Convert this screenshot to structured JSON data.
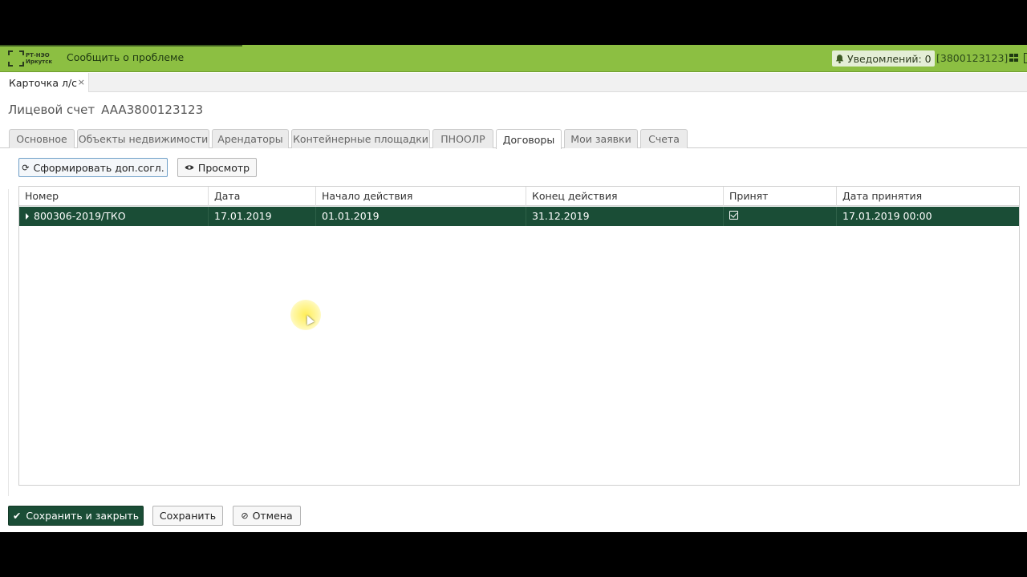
{
  "topbar": {
    "logo_line1": "РТ-НЭО",
    "logo_line2": "Иркутск",
    "report_problem": "Сообщить о проблеме",
    "notifications": "Уведомлений: 0",
    "account_number": "[3800123123]"
  },
  "doc_tab": {
    "label": "Карточка л/с",
    "close": "×"
  },
  "title": {
    "label": "Лицевой счет",
    "account": "AAA3800123123"
  },
  "tabs": [
    {
      "label": "Основное"
    },
    {
      "label": "Объекты недвижимости"
    },
    {
      "label": "Арендаторы"
    },
    {
      "label": "Контейнерные площадки"
    },
    {
      "label": "ПНООЛР"
    },
    {
      "label": "Договоры",
      "active": true
    },
    {
      "label": "Мои заявки"
    },
    {
      "label": "Счета"
    }
  ],
  "toolbar": {
    "generate_label": "Сформировать доп.согл.",
    "view_label": "Просмотр"
  },
  "grid": {
    "columns": [
      "Номер",
      "Дата",
      "Начало действия",
      "Конец действия",
      "Принят",
      "Дата принятия"
    ],
    "rows": [
      {
        "number": "800306-2019/ТКО",
        "date": "17.01.2019",
        "start": "01.01.2019",
        "end": "31.12.2019",
        "accepted": true,
        "accepted_date": "17.01.2019 00:00"
      }
    ]
  },
  "footer": {
    "save_close_label": "Сохранить и закрыть",
    "save_label": "Сохранить",
    "cancel_label": "Отмена"
  },
  "colors": {
    "topbar": "#8cbf42",
    "selected_row": "#1a4d36",
    "primary_button": "#1a4d36"
  }
}
